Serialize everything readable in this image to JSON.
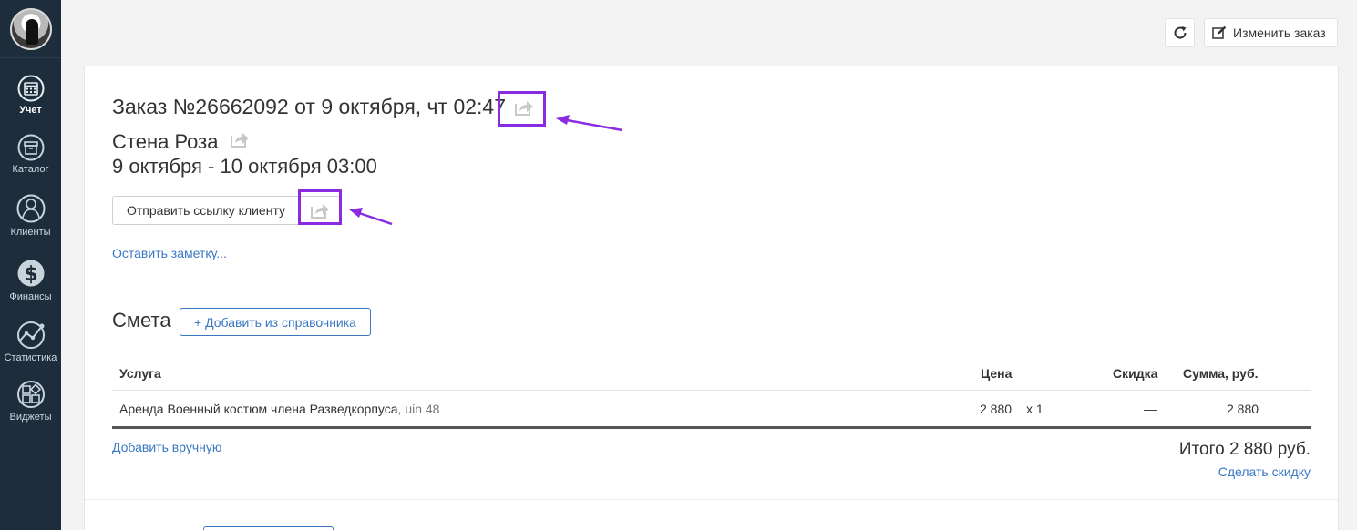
{
  "sidebar": {
    "items": [
      {
        "label": "Учет",
        "icon": "calendar-icon"
      },
      {
        "label": "Каталог",
        "icon": "archive-box-icon"
      },
      {
        "label": "Клиенты",
        "icon": "person-icon"
      },
      {
        "label": "Финансы",
        "icon": "dollar-icon"
      },
      {
        "label": "Статистика",
        "icon": "chart-line-icon"
      },
      {
        "label": "Виджеты",
        "icon": "widgets-icon"
      }
    ]
  },
  "toolbar": {
    "refresh_icon": "refresh-icon",
    "edit_label": "Изменить заказ"
  },
  "order": {
    "title": "Заказ №26662092 от 9 октября, чт 02:47",
    "object_name": "Стена Роза",
    "date_range": "9 октября - 10 октября 03:00",
    "send_link_label": "Отправить ссылку клиенту",
    "note_link": "Оставить заметку..."
  },
  "estimate": {
    "title": "Смета",
    "add_from_ref_label": "+ Добавить из справочника",
    "columns": {
      "service": "Услуга",
      "price": "Цена",
      "discount": "Скидка",
      "sum": "Сумма, руб."
    },
    "rows": [
      {
        "service": "Аренда Военный костюм члена Разведкорпуса",
        "uin": ", uin 48",
        "price": "2 880",
        "qty": "x 1",
        "discount": "—",
        "sum": "2 880"
      }
    ],
    "add_manual_label": "Добавить вручную",
    "total": "Итого 2 880 руб.",
    "discount_link": "Сделать скидку"
  },
  "colors": {
    "sidebar": "#1e2d3b",
    "link": "#3a78c3",
    "annotation": "#8a2be2"
  }
}
